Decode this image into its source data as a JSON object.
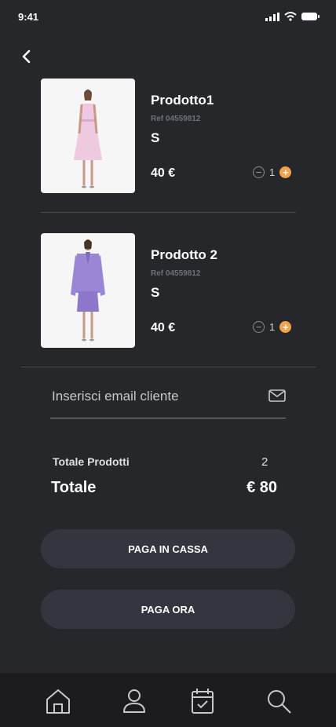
{
  "status_bar": {
    "time": "9:41"
  },
  "products": [
    {
      "name": "Prodotto1",
      "ref": "Ref 04559812",
      "size": "S",
      "price": "40 €",
      "quantity": "1",
      "dress_color": "#efc9e0"
    },
    {
      "name": "Prodotto 2",
      "ref": "Ref 04559812",
      "size": "S",
      "price": "40 €",
      "quantity": "1",
      "dress_color": "#9a86d4"
    }
  ],
  "email": {
    "placeholder": "Inserisci email cliente"
  },
  "summary": {
    "products_label": "Totale Prodotti",
    "products_count": "2",
    "total_label": "Totale",
    "total_value": "€ 80"
  },
  "buttons": {
    "pay_at_register": "PAGA IN CASSA",
    "pay_now": "PAGA ORA"
  },
  "tabbar": {
    "icons": [
      "home-icon",
      "user-icon",
      "calendar-check-icon",
      "search-icon"
    ]
  },
  "colors": {
    "background": "#26272b",
    "accent": "#f0a24d",
    "button": "#33363f"
  }
}
